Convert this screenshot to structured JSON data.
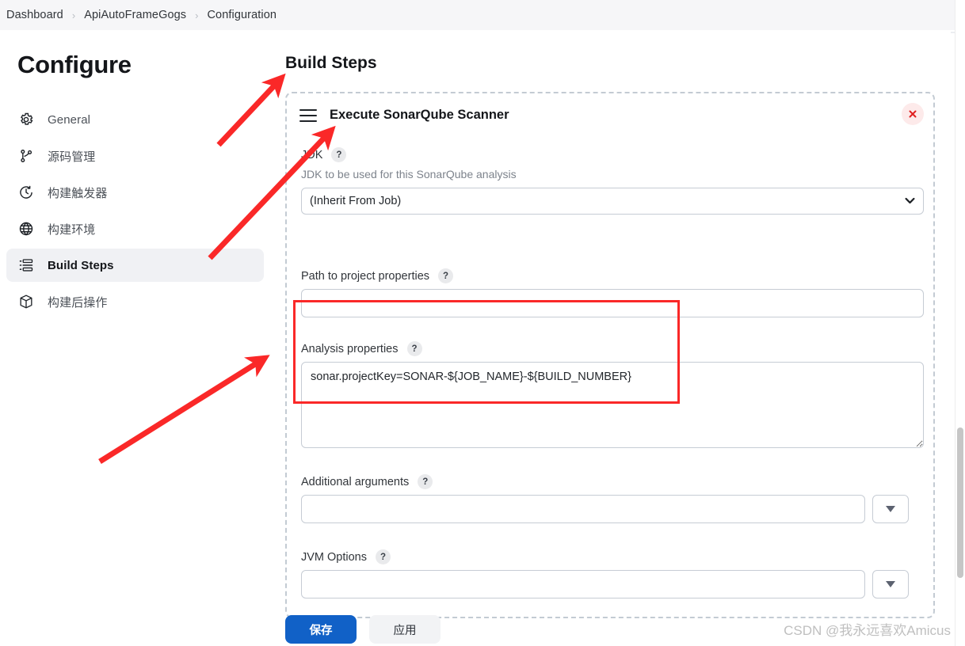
{
  "breadcrumb": {
    "items": [
      {
        "label": "Dashboard"
      },
      {
        "label": "ApiAutoFrameGogs"
      },
      {
        "label": "Configuration"
      }
    ],
    "separator": "›"
  },
  "sidebar": {
    "title": "Configure",
    "items": [
      {
        "label": "General",
        "icon": "gear-icon",
        "active": false
      },
      {
        "label": "源码管理",
        "icon": "git-branch-icon",
        "active": false
      },
      {
        "label": "构建触发器",
        "icon": "clock-icon",
        "active": false
      },
      {
        "label": "构建环境",
        "icon": "globe-icon",
        "active": false
      },
      {
        "label": "Build Steps",
        "icon": "list-icon",
        "active": true
      },
      {
        "label": "构建后操作",
        "icon": "package-icon",
        "active": false
      }
    ]
  },
  "main": {
    "section_title": "Build Steps",
    "step": {
      "title": "Execute SonarQube Scanner",
      "drag_handle_icon": "hamburger-drag-icon",
      "close_icon": "close-icon",
      "fields": {
        "jdk": {
          "label": "JDK",
          "help": "?",
          "description": "JDK to be used for this SonarQube analysis",
          "selected": "(Inherit From Job)",
          "options": [
            "(Inherit From Job)"
          ]
        },
        "path_properties": {
          "label": "Path to project properties",
          "help": "?",
          "value": "",
          "placeholder": ""
        },
        "analysis_properties": {
          "label": "Analysis properties",
          "help": "?",
          "value": "sonar.projectKey=SONAR-${JOB_NAME}-${BUILD_NUMBER}",
          "placeholder": ""
        },
        "additional_arguments": {
          "label": "Additional arguments",
          "help": "?",
          "value": "",
          "placeholder": "",
          "dropdown_icon": "caret-down-icon"
        },
        "jvm_options": {
          "label": "JVM Options",
          "help": "?",
          "value": "",
          "placeholder": "",
          "dropdown_icon": "caret-down-icon"
        }
      }
    }
  },
  "footer": {
    "save_label": "保存",
    "apply_label": "应用"
  },
  "watermark": {
    "text": "CSDN @我永远喜欢Amicus"
  },
  "colors": {
    "primary_button": "#1161c7",
    "annotation_red": "#fa2828",
    "close_red": "#e02020",
    "active_nav_bg": "#f0f1f4"
  }
}
